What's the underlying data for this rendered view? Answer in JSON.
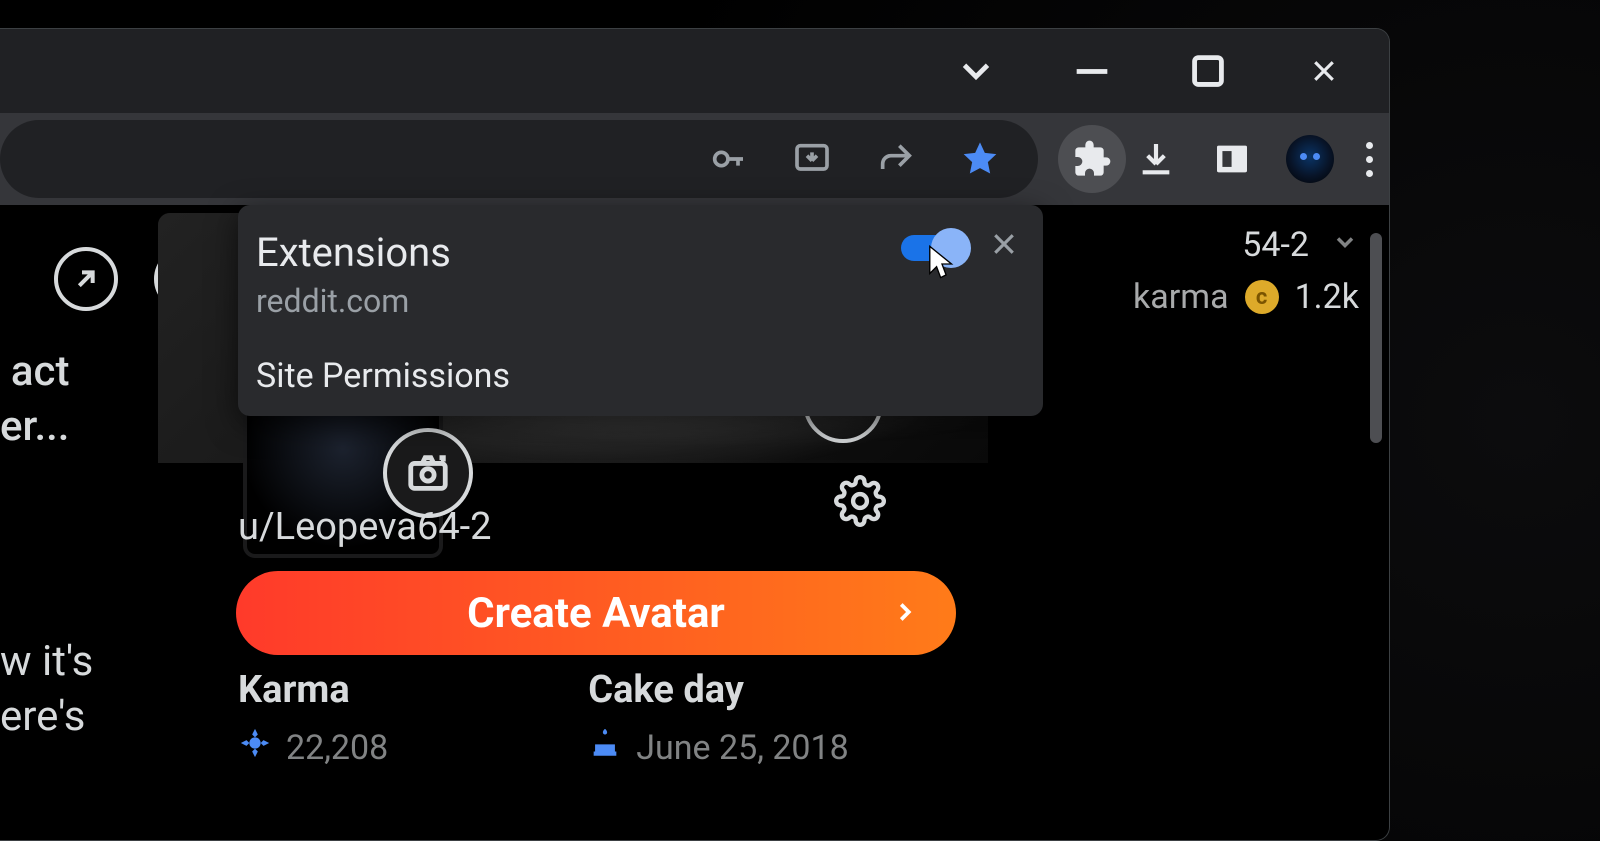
{
  "popup": {
    "title": "Extensions",
    "site": "reddit.com",
    "section": "Site Permissions"
  },
  "toolbar": {
    "icons": {
      "key": "key-icon",
      "install": "install-icon",
      "share": "share-icon",
      "star": "star-icon",
      "extensions": "extensions-icon",
      "download": "download-icon",
      "panel": "side-panel-icon",
      "menu": "menu-icon"
    }
  },
  "left_snippets": {
    "a1": "act",
    "a2": "er...",
    "b1": "w it's",
    "b2": "ere's"
  },
  "profile": {
    "username": "u/Leopeva64-2",
    "create_avatar": "Create Avatar",
    "karma_label": "Karma",
    "karma_value": "22,208",
    "cakeday_label": "Cake day",
    "cakeday_value": "June 25, 2018"
  },
  "right": {
    "name_suffix": "54-2",
    "karma_label": "karma",
    "coin_value": "1.2k"
  }
}
